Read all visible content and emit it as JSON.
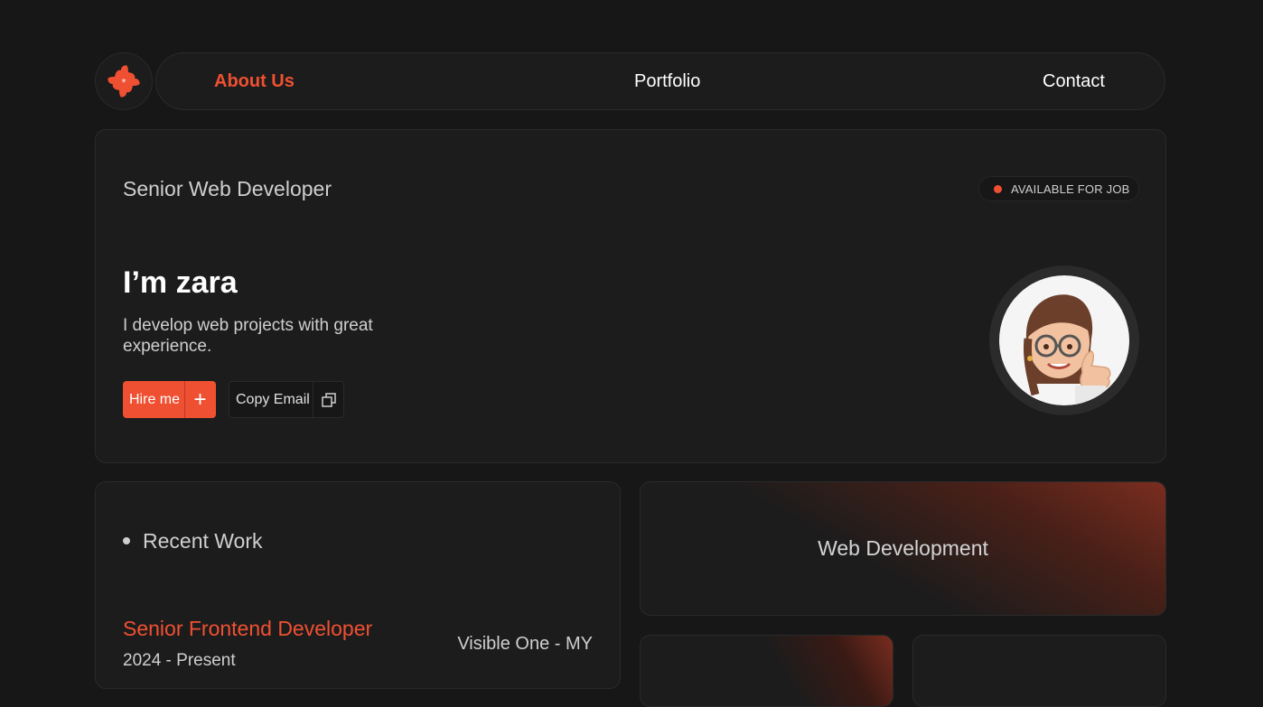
{
  "nav": {
    "links": [
      {
        "label": "About Us",
        "active": true
      },
      {
        "label": "Portfolio",
        "active": false
      },
      {
        "label": "Contact",
        "active": false
      }
    ],
    "logo_icon": "flower-logo-icon"
  },
  "hero": {
    "role": "Senior Web Developer",
    "badge": "AVAILABLE FOR JOB",
    "name": "I’m zara",
    "description": "I develop web projects with great experience.",
    "hire_button": "Hire me",
    "copy_button": "Copy Email",
    "hire_icon": "plus-icon",
    "copy_icon": "copy-icon",
    "avatar_icon": "memoji-avatar"
  },
  "recent_work": {
    "heading": "Recent Work",
    "jobs": [
      {
        "title": "Senior Frontend Developer",
        "company": "Visible One - MY",
        "period": "2024 - Present"
      }
    ]
  },
  "services": {
    "featured": "Web Development"
  },
  "colors": {
    "accent": "#f05032",
    "background": "#171717",
    "card": "#1c1c1c"
  }
}
